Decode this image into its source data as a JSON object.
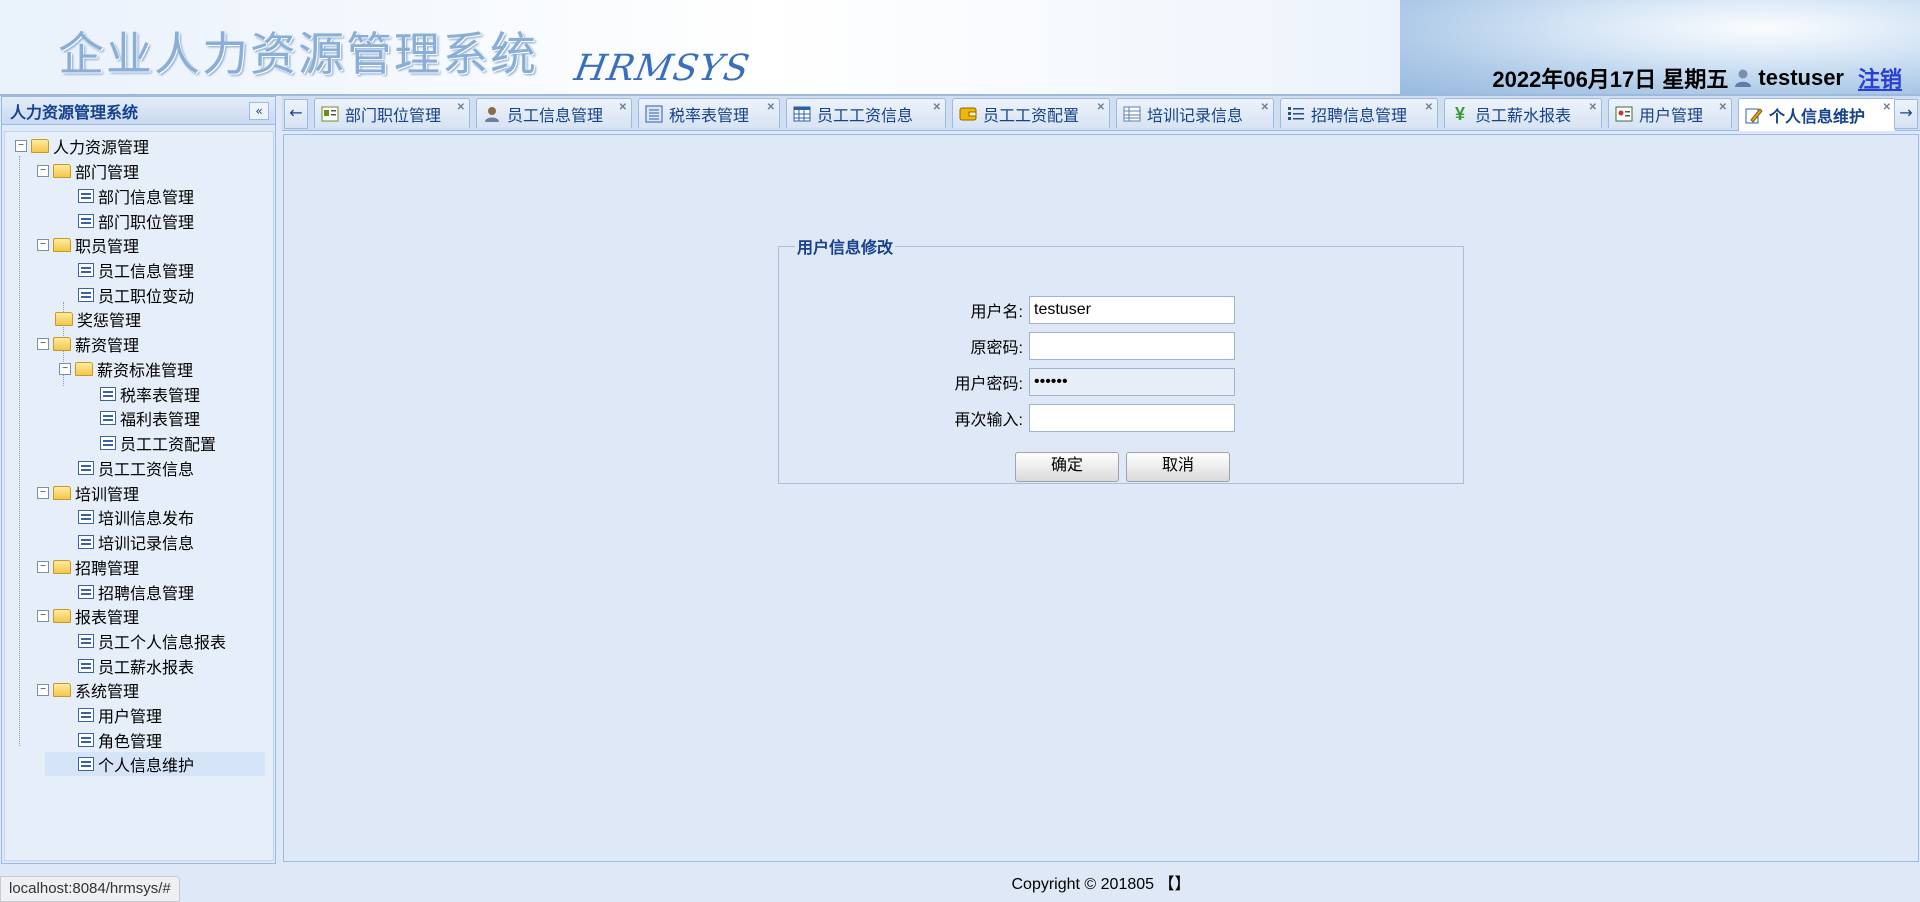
{
  "header": {
    "title": "企业人力资源管理系统",
    "subtitle": "HRMSYS",
    "datetime": "2022年06月17日 星期五",
    "username": "testuser",
    "logout": "注销"
  },
  "sidebar": {
    "title": "人力资源管理系统",
    "tree": {
      "root": "人力资源管理",
      "dept": "部门管理",
      "dept_info": "部门信息管理",
      "dept_position": "部门职位管理",
      "staff": "职员管理",
      "staff_info": "员工信息管理",
      "staff_position_change": "员工职位变动",
      "reward": "奖惩管理",
      "salary": "薪资管理",
      "salary_std": "薪资标准管理",
      "tax_table": "税率表管理",
      "welfare_table": "福利表管理",
      "salary_config": "员工工资配置",
      "salary_info": "员工工资信息",
      "training": "培训管理",
      "training_publish": "培训信息发布",
      "training_record": "培训记录信息",
      "recruit": "招聘管理",
      "recruit_info": "招聘信息管理",
      "report": "报表管理",
      "report_personal": "员工个人信息报表",
      "report_salary": "员工薪水报表",
      "system": "系统管理",
      "user_mgmt": "用户管理",
      "role_mgmt": "角色管理",
      "personal_info": "个人信息维护"
    }
  },
  "tabs": [
    {
      "label": "部门职位管理"
    },
    {
      "label": "员工信息管理"
    },
    {
      "label": "税率表管理"
    },
    {
      "label": "员工工资信息"
    },
    {
      "label": "员工工资配置"
    },
    {
      "label": "培训记录信息"
    },
    {
      "label": "招聘信息管理"
    },
    {
      "label": "员工薪水报表"
    },
    {
      "label": "用户管理"
    },
    {
      "label": "个人信息维护"
    }
  ],
  "form": {
    "legend": "用户信息修改",
    "username_label": "用户名:",
    "username_value": "testuser",
    "old_password_label": "原密码:",
    "old_password_value": "",
    "password_label": "用户密码:",
    "password_value": "••••••",
    "confirm_label": "再次输入:",
    "confirm_value": "",
    "ok_button": "确定",
    "cancel_button": "取消"
  },
  "footer": {
    "copyright": "Copyright © 201805 【】"
  },
  "statusbar": {
    "url": "localhost:8084/hrmsys/#"
  },
  "colors": {
    "panel_bg": "#dfe8f6",
    "border": "#99bbe8",
    "title_blue": "#15428b",
    "logout_link": "#2a3fd6"
  }
}
